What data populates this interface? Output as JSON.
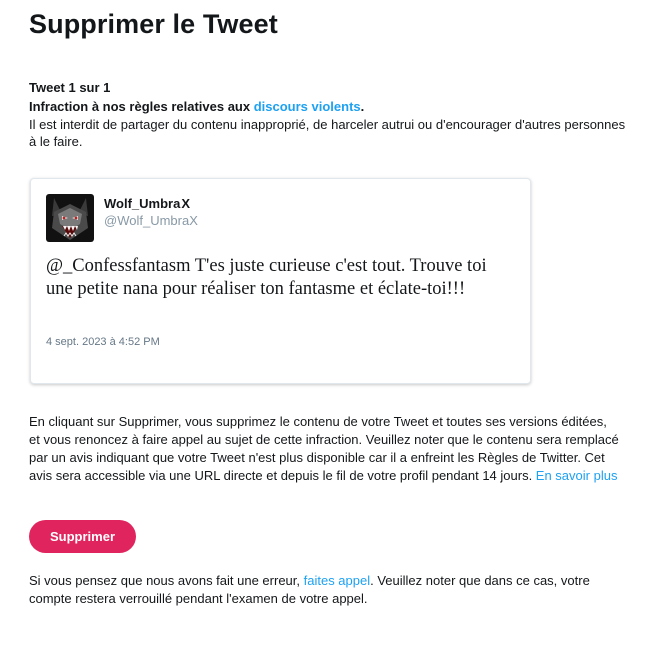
{
  "page": {
    "title": "Supprimer le Tweet"
  },
  "violation": {
    "counter": "Tweet 1 sur 1",
    "heading_prefix": "Infraction à nos règles relatives aux ",
    "heading_link": "discours violents",
    "heading_suffix": ".",
    "description": "Il est interdit de partager du contenu inapproprié, de harceler autrui ou d'encourager d'autres personnes à le faire."
  },
  "tweet": {
    "author_name": "Wolf_Umbra",
    "author_suffix": "X",
    "author_handle": "@Wolf_UmbraX",
    "text": "@_Confessfantasm T'es juste curieuse c'est tout. Trouve toi une petite nana pour réaliser ton fantasme et éclate-toi!!!",
    "date": "4 sept. 2023 à 4:52 PM",
    "avatar_icon": "wolf-avatar-icon"
  },
  "notice": {
    "text": "En cliquant sur Supprimer, vous supprimez le contenu de votre Tweet et toutes ses versions éditées, et vous renoncez à faire appel au sujet de cette infraction. Veuillez noter que le contenu sera remplacé par un avis indiquant que votre Tweet n'est plus disponible car il a enfreint les Règles de Twitter. Cet avis sera accessible via une URL directe et depuis le fil de votre profil pendant 14 jours. ",
    "link": "En savoir plus"
  },
  "actions": {
    "delete_label": "Supprimer"
  },
  "appeal": {
    "prefix": "Si vous pensez que nous avons fait une erreur, ",
    "link": "faites appel",
    "suffix": ". Veuillez noter que dans ce cas, votre compte restera verrouillé pendant l'examen de votre appel."
  },
  "colors": {
    "accent_link": "#1da1f2",
    "delete_button": "#e0245e",
    "muted_text": "#657786"
  }
}
